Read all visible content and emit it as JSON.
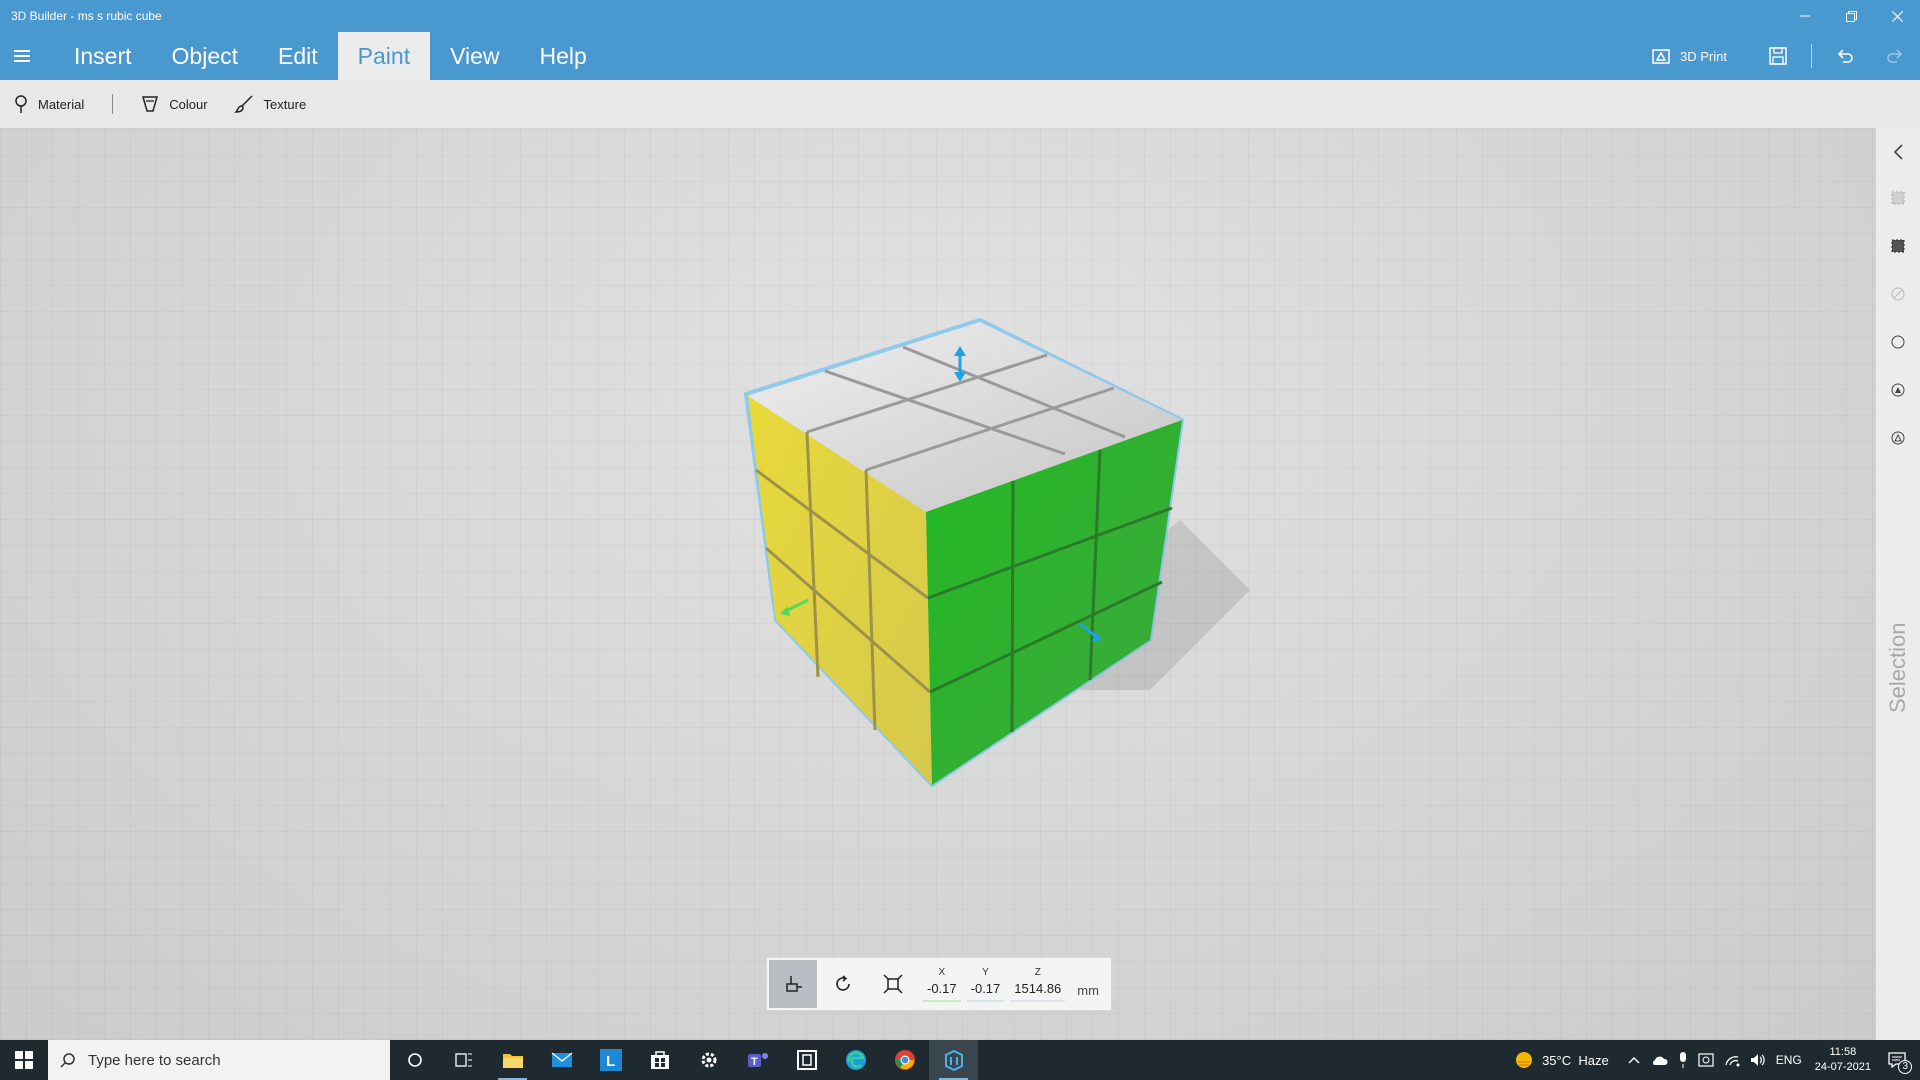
{
  "window": {
    "title": "3D Builder - ms s rubic cube",
    "controls": [
      "minimize-icon",
      "restore-icon",
      "close-icon"
    ]
  },
  "menu": {
    "items": [
      "Insert",
      "Object",
      "Edit",
      "Paint",
      "View",
      "Help"
    ],
    "active": "Paint",
    "print_label": "3D Print"
  },
  "toolbar": {
    "material": "Material",
    "colour": "Colour",
    "texture": "Texture"
  },
  "side_panel": {
    "label": "Selection"
  },
  "transform": {
    "x_label": "X",
    "x_value": "-0.17",
    "y_label": "Y",
    "y_value": "-0.17",
    "z_label": "Z",
    "z_value": "1514.86",
    "unit": "mm"
  },
  "model": {
    "colors": {
      "top": "#dcdcdc",
      "left": "#e0d24a",
      "right": "#35b035",
      "outline": "#7cc4ee"
    },
    "gizmo_colors": {
      "vertical": "#1fa3e6",
      "horizontal_left": "#57d957",
      "horizontal_right": "#1fa3e6"
    }
  },
  "taskbar": {
    "search_placeholder": "Type here to search",
    "weather": "35°C  Haze",
    "language": "ENG",
    "time": "11:58",
    "date": "24-07-2021",
    "notification_count": "3"
  },
  "colors": {
    "accent": "#4a98d0",
    "toolbar_bg": "#e8e8e8",
    "taskbar_bg": "#1f2a30"
  }
}
